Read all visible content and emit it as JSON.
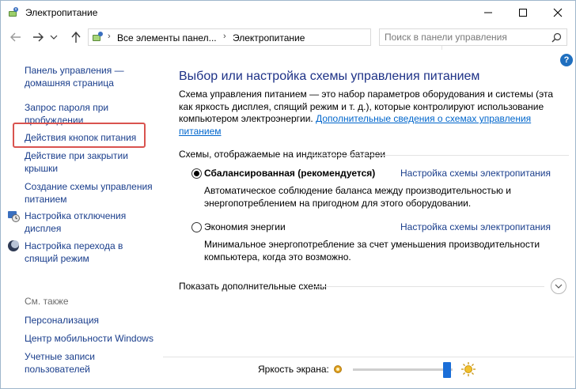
{
  "window": {
    "title": "Электропитание",
    "controls": [
      "minimize",
      "maximize",
      "close"
    ]
  },
  "address_bar": {
    "crumbs": [
      "Все элементы панел...",
      "Электропитание"
    ],
    "search_placeholder": "Поиск в панели управления"
  },
  "help_label": "?",
  "sidebar": {
    "links": [
      "Панель управления — домашняя страница",
      "Запрос пароля при пробуждении",
      "Действия кнопок питания",
      "Действие при закрытии крышки",
      "Создание схемы управления питанием",
      "Настройка отключения дисплея",
      "Настройка перехода в спящий режим"
    ],
    "see_also_label": "См. также",
    "see_also": [
      "Персонализация",
      "Центр мобильности Windows",
      "Учетные записи пользователей"
    ]
  },
  "main": {
    "heading": "Выбор или настройка схемы управления питанием",
    "description": "Схема управления питанием — это набор параметров оборудования и системы (эта как яркость дисплея, спящий режим и т. д.), которые контролируют использование компьютером электроэнергии.",
    "description_link": "Дополнительные сведения о схемах управления питанием",
    "group_label": "Схемы, отображаемые на индикаторе батареи",
    "plans": [
      {
        "name": "Сбалансированная (рекомендуется)",
        "selected": true,
        "link": "Настройка схемы электропитания",
        "description": "Автоматическое соблюдение баланса между производительностью и энергопотреблением на пригодном для этого оборудовании."
      },
      {
        "name": "Экономия энергии",
        "selected": false,
        "link": "Настройка схемы электропитания",
        "description": "Минимальное энергопотребление за счет уменьшения производительности компьютера, когда это возможно."
      }
    ],
    "more_plans_label": "Показать дополнительные схемы"
  },
  "brightness": {
    "label": "Яркость экрана:",
    "level_fraction": 0.98
  },
  "colors": {
    "link": "#1a3e8c",
    "heading": "#1e3287",
    "accent": "#1a6ed8",
    "highlight": "#d9534f"
  }
}
